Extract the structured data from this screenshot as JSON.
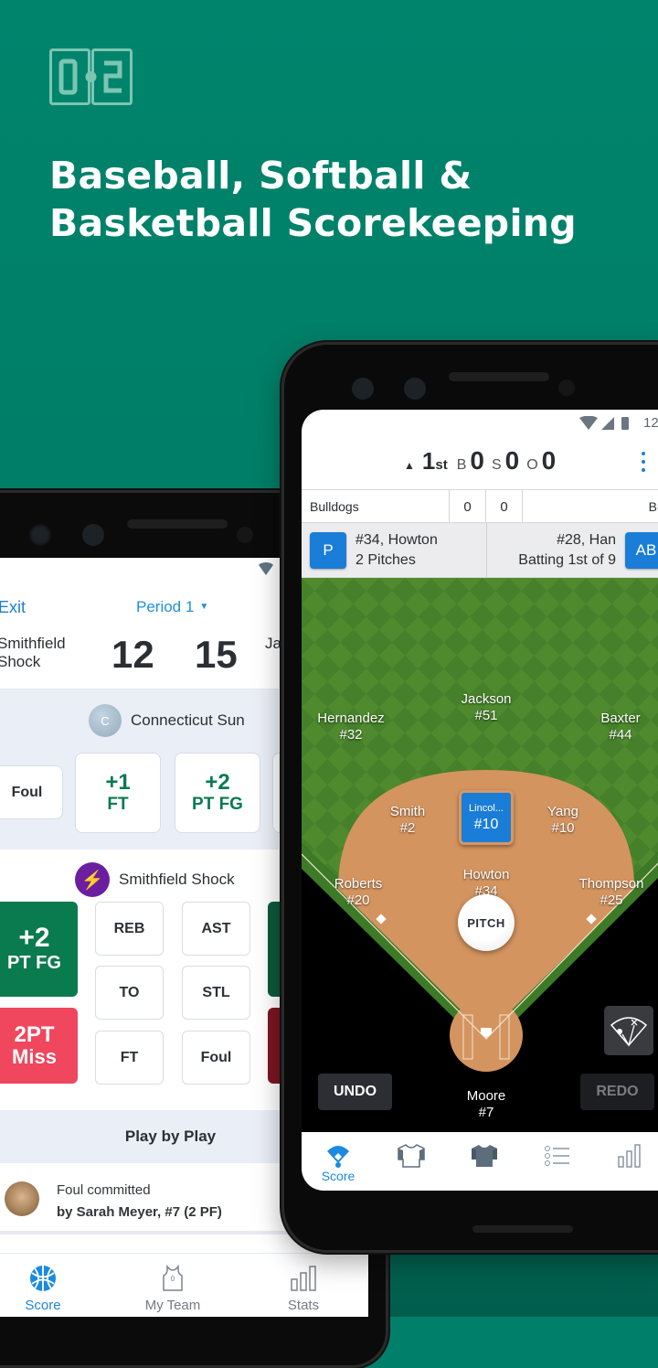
{
  "promo": {
    "logo_text": "0:2",
    "headline_line1": "Baseball, Softball &",
    "headline_line2": "Basketball Scorekeeping",
    "background_color": "#00806a"
  },
  "basketball_app": {
    "header": {
      "exit_label": "Exit",
      "period_label": "Period 1",
      "home_team_line1": "Smithfield",
      "home_team_line2": "Shock",
      "home_score": "12",
      "away_score": "15",
      "away_team_partial": "Ja"
    },
    "opponent_section": {
      "team_name": "Connecticut Sun",
      "avatar_letter": "C",
      "buttons": [
        {
          "line1": "Foul",
          "line2": ""
        },
        {
          "line1": "+1",
          "line2": "FT"
        },
        {
          "line1": "+2",
          "line2": "PT FG"
        }
      ]
    },
    "home_section": {
      "team_name": "Smithfield Shock",
      "make_button": {
        "line1": "+2",
        "line2": "PT FG",
        "color": "#0a7a4f"
      },
      "miss_button": {
        "line1": "2PT",
        "line2": "Miss",
        "color": "#f0415c"
      },
      "stat_buttons": [
        "REB",
        "AST",
        "TO",
        "STL",
        "FT",
        "Foul"
      ]
    },
    "play_by_play": {
      "title": "Play by Play",
      "items": [
        {
          "line1": "Foul committed",
          "line2": "by Sarah Meyer, #7 (2 PF)"
        }
      ]
    },
    "nav": [
      {
        "label": "Score",
        "icon": "basketball-icon",
        "active": true
      },
      {
        "label": "My Team",
        "icon": "jersey-icon",
        "active": false
      },
      {
        "label": "Stats",
        "icon": "bar-chart-icon",
        "active": false
      }
    ]
  },
  "baseball_app": {
    "status_bar": {
      "time_partial": "12"
    },
    "scoreboard": {
      "half": "top",
      "inning_number": "1",
      "inning_suffix": "st",
      "balls_label": "B",
      "balls": "0",
      "strikes_label": "S",
      "strikes": "0",
      "outs_label": "O",
      "outs": "0"
    },
    "lineup_bar": {
      "away_team": "Bulldogs",
      "away_runs": "0",
      "home_runs": "0",
      "home_team_partial": "Bulls"
    },
    "matchup": {
      "pitcher_badge": "P",
      "pitcher_line1": "#34, Howton",
      "pitcher_line2": "2 Pitches",
      "batter_line1": "#28, Han",
      "batter_line2": "Batting 1st of 9",
      "batter_badge": "AB"
    },
    "fielders": [
      {
        "name": "Hernandez",
        "number": "#32"
      },
      {
        "name": "Jackson",
        "number": "#51"
      },
      {
        "name": "Baxter",
        "number": "#44"
      },
      {
        "name": "Smith",
        "number": "#2"
      },
      {
        "name": "Yang",
        "number": "#10"
      },
      {
        "name": "Roberts",
        "number": "#20"
      },
      {
        "name": "Howton",
        "number": "#34"
      },
      {
        "name": "Thompson",
        "number": "#25"
      },
      {
        "name": "Moore",
        "number": "#7"
      }
    ],
    "selected_player": {
      "name": "Lincol...",
      "number": "#10"
    },
    "pitch_button": "PITCH",
    "undo_label": "UNDO",
    "redo_label": "REDO",
    "nav": [
      {
        "label": "Score",
        "icon": "field-icon",
        "active": true
      },
      {
        "label": "",
        "icon": "away-jersey-icon",
        "active": false
      },
      {
        "label": "",
        "icon": "home-jersey-icon",
        "active": false
      },
      {
        "label": "",
        "icon": "list-icon",
        "active": false
      },
      {
        "label": "",
        "icon": "bar-chart-icon",
        "active": false
      }
    ],
    "accent_color": "#1a7dd7"
  }
}
